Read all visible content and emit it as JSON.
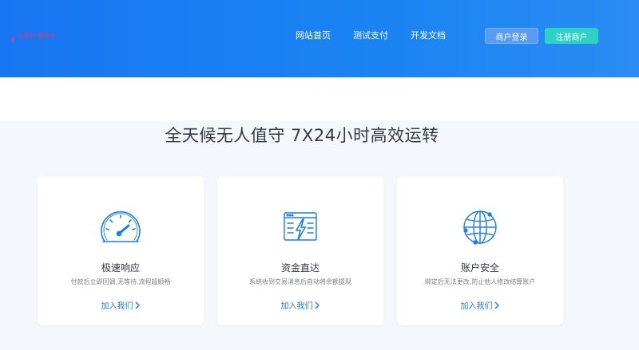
{
  "header": {
    "logo_text": "云易付 聚支付",
    "nav": [
      "网站首页",
      "测试支付",
      "开发文档"
    ],
    "login_label": "商户登录",
    "register_label": "注册商户"
  },
  "section": {
    "title": "全天候无人值守 7X24小时高效运转"
  },
  "cards": [
    {
      "icon": "speedometer-icon",
      "title": "极速响应",
      "desc": "付款后立即回调,无等待,流程超顺畅",
      "link": "加入我们"
    },
    {
      "icon": "lightning-window-icon",
      "title": "资金直达",
      "desc": "系统收到交易消息后自动将余额提现",
      "link": "加入我们"
    },
    {
      "icon": "globe-network-icon",
      "title": "账户安全",
      "desc": "绑定后无法更改,防止他人修改结算账户",
      "link": "加入我们"
    }
  ],
  "colors": {
    "header_blue": "#1777f2",
    "register_teal": "#2fd1c4",
    "login_blue": "#5a9bf6",
    "icon_blue": "#1a7ef2",
    "logo_pink": "#ff2a6a",
    "section_bg": "#f4f8fc"
  }
}
